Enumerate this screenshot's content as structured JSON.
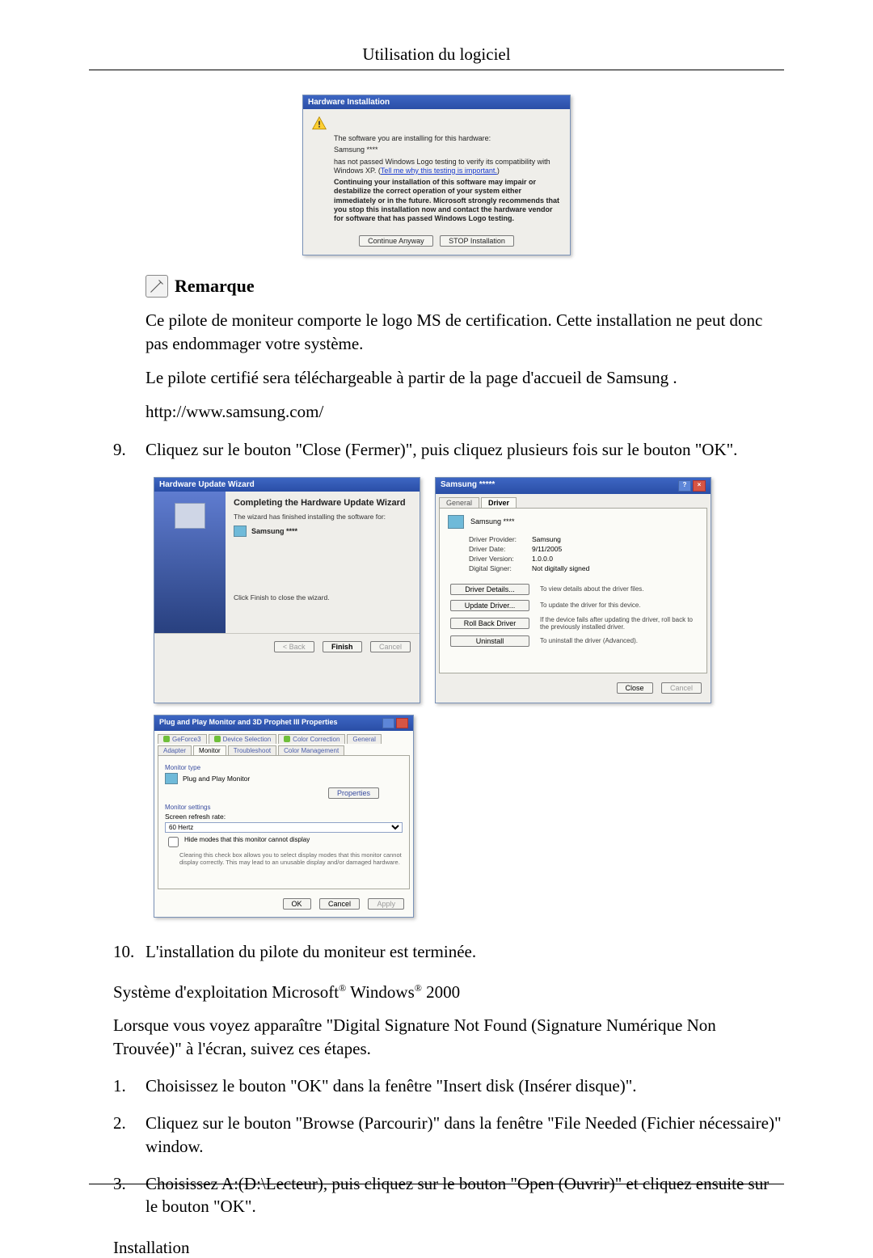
{
  "header": {
    "title": "Utilisation du logiciel"
  },
  "hwInstall": {
    "title": "Hardware Installation",
    "line1": "The software you are installing for this hardware:",
    "device": "Samsung ****",
    "notPassed": "has not passed Windows Logo testing to verify its compatibility with Windows XP. (",
    "tellMe": "Tell me why this testing is important.",
    "notPassedEnd": ")",
    "warn": "Continuing your installation of this software may impair or destabilize the correct operation of your system either immediately or in the future. Microsoft strongly recommends that you stop this installation now and contact the hardware vendor for software that has passed Windows Logo testing.",
    "btnContinue": "Continue Anyway",
    "btnStop": "STOP Installation"
  },
  "remarque": {
    "label": "Remarque",
    "p1": "Ce pilote de moniteur comporte le logo MS de certification. Cette installation ne peut donc pas endommager votre système.",
    "p2": "Le pilote certifié sera téléchargeable à partir de la page d'accueil de Samsung .",
    "url": "http://www.samsung.com/"
  },
  "step9": {
    "num": "9.",
    "text": "Cliquez sur le bouton \"Close (Fermer)\", puis cliquez plusieurs fois sur le bouton \"OK\"."
  },
  "wizard": {
    "title": "Hardware Update Wizard",
    "heading": "Completing the Hardware Update Wizard",
    "sub": "The wizard has finished installing the software for:",
    "device": "Samsung ****",
    "closing": "Click Finish to close the wizard.",
    "btnBack": "< Back",
    "btnFinish": "Finish",
    "btnCancel": "Cancel"
  },
  "props": {
    "title": "Samsung *****",
    "tabGeneral": "General",
    "tabDriver": "Driver",
    "device": "Samsung ****",
    "kProvider": "Driver Provider:",
    "vProvider": "Samsung",
    "kDate": "Driver Date:",
    "vDate": "9/11/2005",
    "kVersion": "Driver Version:",
    "vVersion": "1.0.0.0",
    "kSigner": "Digital Signer:",
    "vSigner": "Not digitally signed",
    "btnDetails": "Driver Details...",
    "descDetails": "To view details about the driver files.",
    "btnUpdate": "Update Driver...",
    "descUpdate": "To update the driver for this device.",
    "btnRollback": "Roll Back Driver",
    "descRollback": "If the device fails after updating the driver, roll back to the previously installed driver.",
    "btnUninstall": "Uninstall",
    "descUninstall": "To uninstall the driver (Advanced).",
    "btnClose": "Close",
    "btnCancel": "Cancel"
  },
  "disp": {
    "title": "Plug and Play Monitor and 3D Prophet III Properties",
    "tabs": [
      "GeForce3",
      "Device Selection",
      "Color Correction",
      "General",
      "Adapter",
      "Monitor",
      "Troubleshoot",
      "Color Management"
    ],
    "grpMonitorType": "Monitor type",
    "pnp": "Plug and Play Monitor",
    "btnProperties": "Properties",
    "grpSettings": "Monitor settings",
    "refreshLabel": "Screen refresh rate:",
    "refreshValue": "60 Hertz",
    "chk": "Hide modes that this monitor cannot display",
    "hint": "Clearing this check box allows you to select display modes that this monitor cannot display correctly. This may lead to an unusable display and/or damaged hardware.",
    "btnOK": "OK",
    "btnCancel": "Cancel",
    "btnApply": "Apply"
  },
  "step10": {
    "num": "10.",
    "text": "L'installation du pilote du moniteur est terminée."
  },
  "os2000": {
    "line": "Système d'exploitation Microsoft",
    "reg1": "®",
    "win": " Windows",
    "reg2": "®",
    "ver": " 2000",
    "intro": "Lorsque vous voyez apparaître \"Digital Signature Not Found (Signature Numérique Non Trouvée)\" à l'écran, suivez ces étapes."
  },
  "list2000": {
    "n1": "1.",
    "t1": "Choisissez le bouton \"OK\" dans la fenêtre \"Insert disk (Insérer disque)\".",
    "n2": "2.",
    "t2": "Cliquez sur le bouton \"Browse (Parcourir)\" dans la fenêtre \"File Needed (Fichier nécessaire)\" window.",
    "n3": "3.",
    "t3": "Choisissez A:(D:\\Lecteur), puis cliquez sur le bouton \"Open (Ouvrir)\" et cliquez ensuite sur le bouton \"OK\"."
  },
  "installHeading": "Installation"
}
